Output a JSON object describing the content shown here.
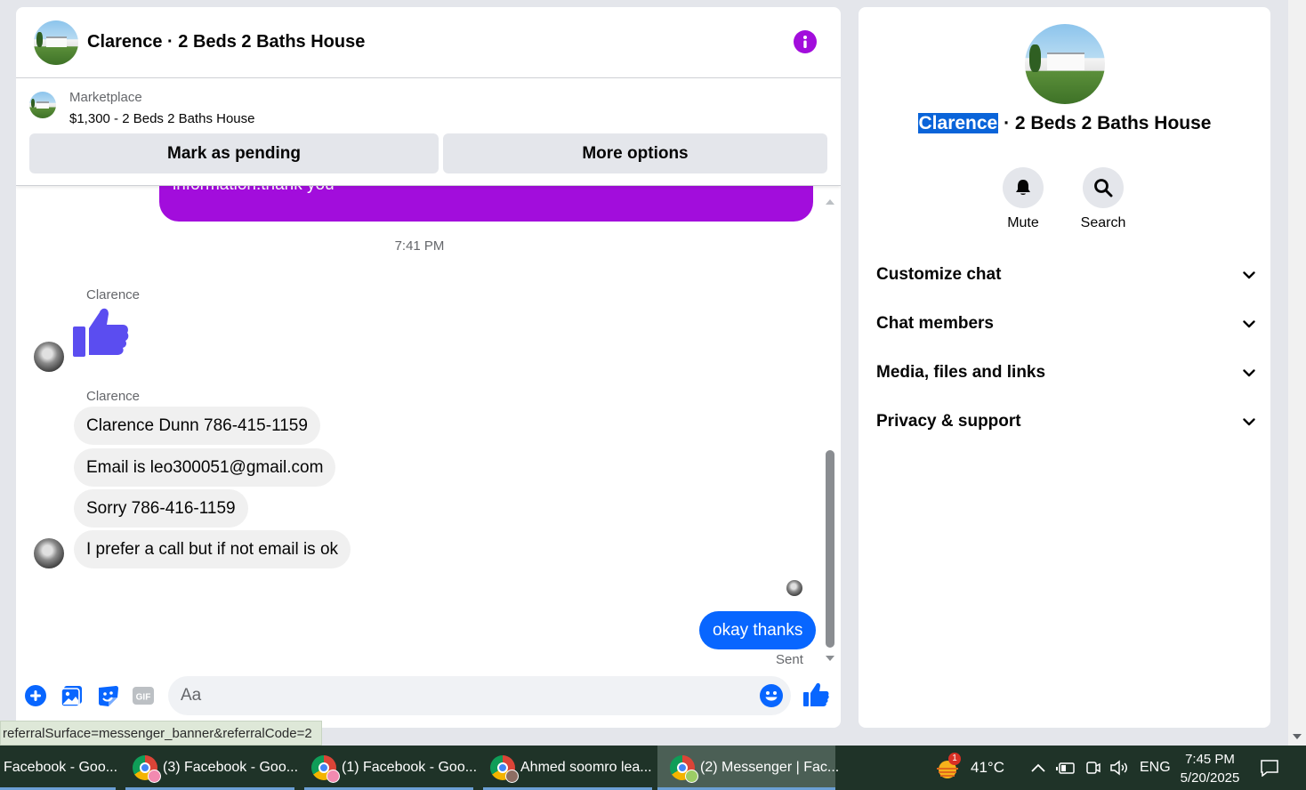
{
  "chat": {
    "title": "Clarence · 2 Beds 2 Baths House",
    "marketplace": {
      "label": "Marketplace",
      "listing": "$1,300 - 2 Beds 2 Baths House",
      "mark_pending": "Mark as pending",
      "more_options": "More options"
    },
    "messages": {
      "outgoing_partial": "information.thank you",
      "timestamp": "7:41 PM",
      "sender_1": "Clarence",
      "sender_2": "Clarence",
      "incoming": [
        "Clarence Dunn 786-415-1159",
        "Email is leo300051@gmail.com",
        "Sorry 786-416-1159",
        "I prefer a call but if not email is ok"
      ],
      "outgoing": "okay thanks",
      "status": "Sent"
    },
    "composer": {
      "placeholder": "Aa",
      "gif_label": "GIF"
    }
  },
  "status_url": "referralSurface=messenger_banner&referralCode=2",
  "info_panel": {
    "name_highlight": "Clarence",
    "title_rest": " · 2 Beds 2 Baths House",
    "actions": {
      "mute": "Mute",
      "search": "Search"
    },
    "sections": [
      "Customize chat",
      "Chat members",
      "Media, files and links",
      "Privacy & support"
    ]
  },
  "taskbar": {
    "tasks": [
      "Facebook - Goo...",
      "(3) Facebook - Goo...",
      "(1) Facebook - Goo...",
      "Ahmed soomro lea...",
      "(2) Messenger | Fac..."
    ],
    "weather_badge": "1",
    "temperature": "41°C",
    "language": "ENG",
    "time": "7:45 PM",
    "date": "5/20/2025"
  },
  "colors": {
    "messenger_blue": "#0866ff",
    "purple_bubble": "#a20ddc",
    "info_icon": "#a20ddc",
    "thumb_purple": "#5b4df0",
    "taskbar": "#1f3328"
  }
}
